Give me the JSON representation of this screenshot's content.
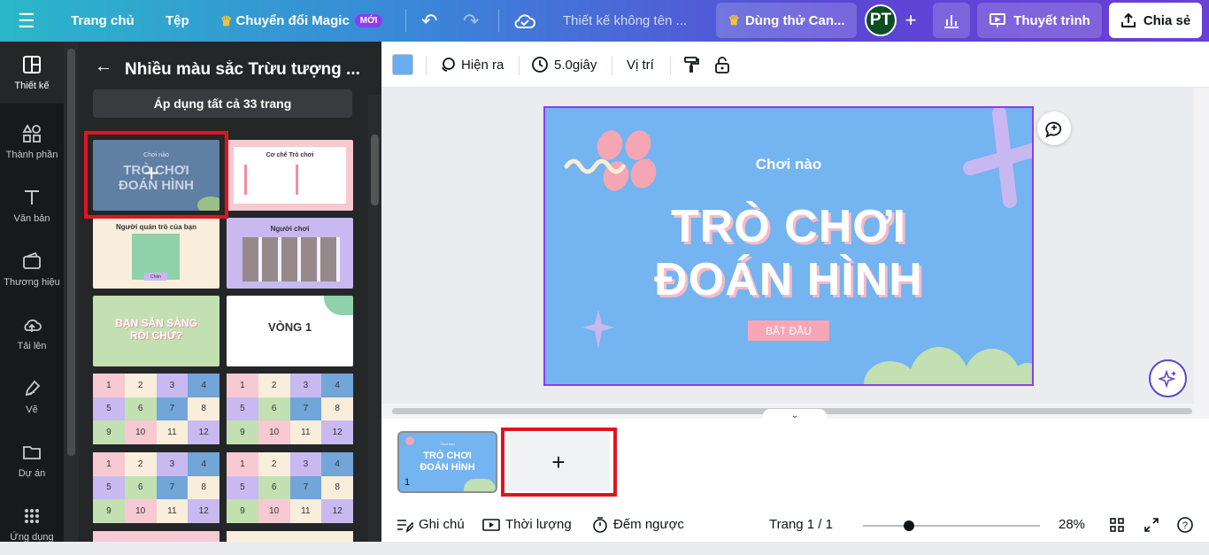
{
  "topbar": {
    "home": "Trang chủ",
    "file": "Tệp",
    "magic": "Chuyển đổi Magic",
    "magic_badge": "MỚI",
    "design_name": "Thiết kế không tên ...",
    "try": "Dùng thử Can...",
    "avatar": "PT",
    "present": "Thuyết trình",
    "share": "Chia sẻ"
  },
  "leftnav": {
    "items": [
      "Thiết kế",
      "Thành phần",
      "Văn bản",
      "Thương hiệu",
      "Tải lên",
      "Vẽ",
      "Dự án",
      "Ứng dụng"
    ]
  },
  "panel": {
    "title": "Nhiều màu sắc Trừu tượng ...",
    "apply_all": "Áp dụng tất cả 33 trang",
    "t1": {
      "sub": "Chơi nào",
      "title1": "TRÒ CHƠI",
      "title2": "ĐOÁN HÌNH"
    },
    "t2": {
      "title": "Cơ chế Trò chơi"
    },
    "t3": {
      "title": "Người quản trò của bạn",
      "name": "Chân"
    },
    "t4": {
      "title": "Người chơi"
    },
    "t5": {
      "title1": "BẠN SẴN SÀNG",
      "title2": "RỒI CHỨ?"
    },
    "t6": {
      "title": "VÒNG 1"
    },
    "grid_numbers": [
      "1",
      "2",
      "3",
      "4",
      "5",
      "6",
      "7",
      "8",
      "9",
      "10",
      "11",
      "12"
    ]
  },
  "toolbar2": {
    "color": "#6aacf0",
    "animate": "Hiện ra",
    "duration": "5.0giây",
    "position": "Vị trí"
  },
  "slide": {
    "subtitle": "Chơi nào",
    "title_line1": "TRÒ CHƠI",
    "title_line2": "ĐOÁN HÌNH",
    "start_button": "BẮT ĐẦU",
    "page_number": "1"
  },
  "bottombar": {
    "notes": "Ghi chú",
    "duration": "Thời lượng",
    "timer": "Đếm ngược",
    "page": "Trang 1 / 1",
    "zoom": "28%"
  }
}
